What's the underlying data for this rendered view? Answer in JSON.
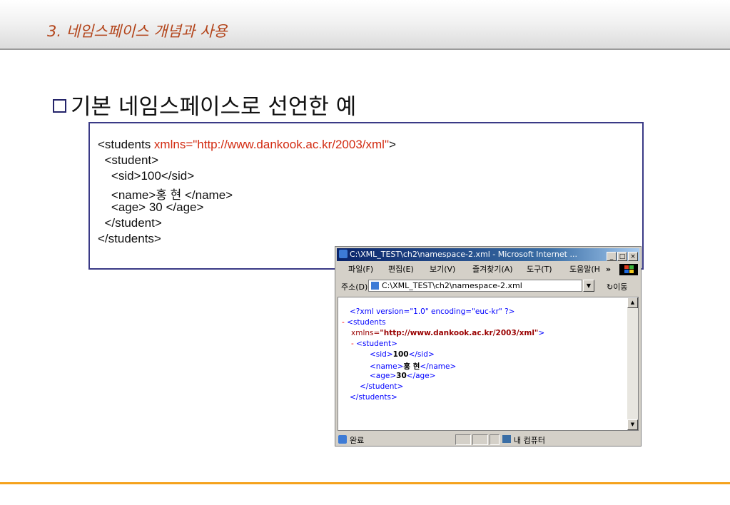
{
  "header": {
    "section_title": "3. 네임스페이스 개념과 사용"
  },
  "slide": {
    "heading": "기본 네임스페이스로 선언한 예"
  },
  "code": {
    "line1_open": "<students ",
    "line1_attr": "xmlns=\"http://www.dankook.ac.kr/2003/xml\"",
    "line1_close": ">",
    "line2": "  <student>",
    "line3": "    <sid>100</sid>",
    "line4": "    <name>홍 현 </name>",
    "line5": "    <age> 30 </age>",
    "line6": "  </student>",
    "line7": "</students>"
  },
  "browser": {
    "title": "C:\\XML_TEST\\ch2\\namespace-2.xml - Microsoft Internet ...",
    "menu": [
      "파일(F)",
      "편집(E)",
      "보기(V)",
      "즐겨찾기(A)",
      "도구(T)",
      "도움말(H"
    ],
    "menu_more": "»",
    "address_label": "주소(D)",
    "address_value": "C:\\XML_TEST\\ch2\\namespace-2.xml",
    "go_label": "이동",
    "xml": {
      "pi": "<?xml version=\"1.0\" encoding=\"euc-kr\" ?>",
      "collapse1": "-",
      "students_tag": "<students",
      "xmlns_attr": "xmlns=",
      "xmlns_value": "\"http://www.dankook.ac.kr/2003/xml\"",
      "xmlns_close": ">",
      "collapse2": "-",
      "student_tag": "<student>",
      "sid_open": "<sid>",
      "sid_value": "100",
      "sid_close": "</sid>",
      "name_open": "<name>",
      "name_value": "홍 현",
      "name_close": "</name>",
      "age_open": "<age>",
      "age_value": "30",
      "age_close": "</age>",
      "student_close": "</student>",
      "students_close": "</students>"
    },
    "status_text": "완료",
    "zone_text": "내 컴퓨터"
  }
}
